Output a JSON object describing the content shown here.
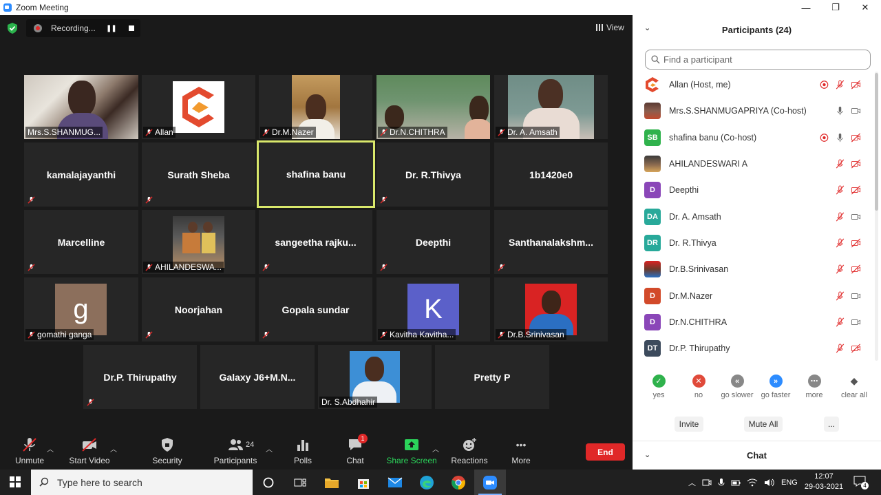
{
  "window": {
    "title": "Zoom Meeting",
    "minimize": "—",
    "restore": "❐",
    "close": "✕"
  },
  "recording": {
    "label": "Recording...",
    "pause": "❚❚"
  },
  "view": {
    "label": "View"
  },
  "tiles": {
    "t1": "Mrs.S.SHANMUG...",
    "t2": "Allan",
    "t3": "Dr.M.Nazer",
    "t4": "Dr.N.CHITHRA",
    "t5": "Dr. A. Amsath",
    "t6": "kamalajayanthi",
    "t7": "Surath Sheba",
    "t8": "shafina banu",
    "t9": "Dr. R.Thivya",
    "t10": "1b1420e0",
    "t11": "Marcelline",
    "t12": "AHILANDESWA...",
    "t13": "sangeetha  rajku...",
    "t14": "Deepthi",
    "t15": "Santhanalakshm...",
    "t16": "gomathi ganga",
    "t16_initial": "g",
    "t17": "Noorjahan",
    "t18": "Gopala sundar",
    "t19": "Kavitha Kavitha...",
    "t19_initial": "K",
    "t20": "Dr.B.Srinivasan",
    "t21": "Dr.P. Thirupathy",
    "t22": "Galaxy  J6+M.N...",
    "t23": "Dr. S.Abdhahir",
    "t24": "Pretty P"
  },
  "toolbar": {
    "unmute": "Unmute",
    "start_video": "Start Video",
    "security": "Security",
    "participants": "Participants",
    "participants_count": "24",
    "polls": "Polls",
    "chat": "Chat",
    "chat_badge": "1",
    "share_screen": "Share Screen",
    "reactions": "Reactions",
    "more": "More",
    "more_dots": "•••",
    "end": "End"
  },
  "panel": {
    "title": "Participants (24)",
    "search_placeholder": "Find a participant",
    "participants": [
      {
        "name": "Allan (Host, me)",
        "initials": ""
      },
      {
        "name": "Mrs.S.SHANMUGAPRIYA (Co-host)",
        "initials": ""
      },
      {
        "name": "shafina banu (Co-host)",
        "initials": "SB"
      },
      {
        "name": "AHILANDESWARI A",
        "initials": ""
      },
      {
        "name": "Deepthi",
        "initials": "D"
      },
      {
        "name": "Dr. A. Amsath",
        "initials": "DA"
      },
      {
        "name": "Dr. R.Thivya",
        "initials": "DR"
      },
      {
        "name": "Dr.B.Srinivasan",
        "initials": ""
      },
      {
        "name": "Dr.M.Nazer",
        "initials": "D"
      },
      {
        "name": "Dr.N.CHITHRA",
        "initials": "D"
      },
      {
        "name": "Dr.P. Thirupathy",
        "initials": "DT"
      }
    ],
    "feedback": {
      "yes": "yes",
      "no": "no",
      "go_slower": "go slower",
      "go_faster": "go faster",
      "more": "more",
      "clear_all": "clear all"
    },
    "invite": "Invite",
    "mute_all": "Mute All",
    "more_btn": "...",
    "chat_title": "Chat"
  },
  "taskbar": {
    "search_placeholder": "Type here to search",
    "lang": "ENG",
    "time": "12:07",
    "date": "29-03-2021",
    "notif_count": "4"
  },
  "colors": {
    "accent": "#2d8cff",
    "end_red": "#e02828",
    "share_green": "#2bd45a",
    "active_speaker": "#d9e86b"
  }
}
